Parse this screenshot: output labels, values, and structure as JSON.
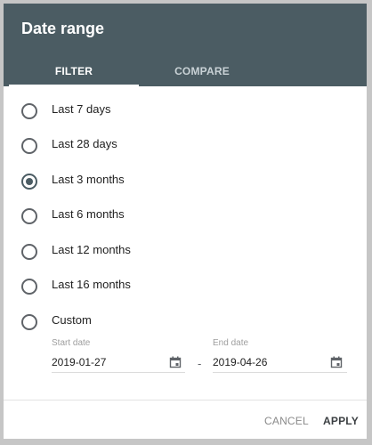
{
  "dialog": {
    "title": "Date range",
    "tabs": [
      {
        "label": "FILTER",
        "active": true
      },
      {
        "label": "COMPARE",
        "active": false
      }
    ],
    "options": [
      {
        "label": "Last 7 days",
        "selected": false
      },
      {
        "label": "Last 28 days",
        "selected": false
      },
      {
        "label": "Last 3 months",
        "selected": true
      },
      {
        "label": "Last 6 months",
        "selected": false
      },
      {
        "label": "Last 12 months",
        "selected": false
      },
      {
        "label": "Last 16 months",
        "selected": false
      },
      {
        "label": "Custom",
        "selected": false
      }
    ],
    "custom": {
      "start_caption": "Start date",
      "start_value": "2019-01-27",
      "separator": "-",
      "end_caption": "End date",
      "end_value": "2019-04-26"
    },
    "actions": {
      "cancel_label": "CANCEL",
      "apply_label": "APPLY"
    }
  },
  "colors": {
    "header_bg": "#4b5c63",
    "accent": "#4b5c63",
    "backdrop": "#c6c6c6"
  }
}
